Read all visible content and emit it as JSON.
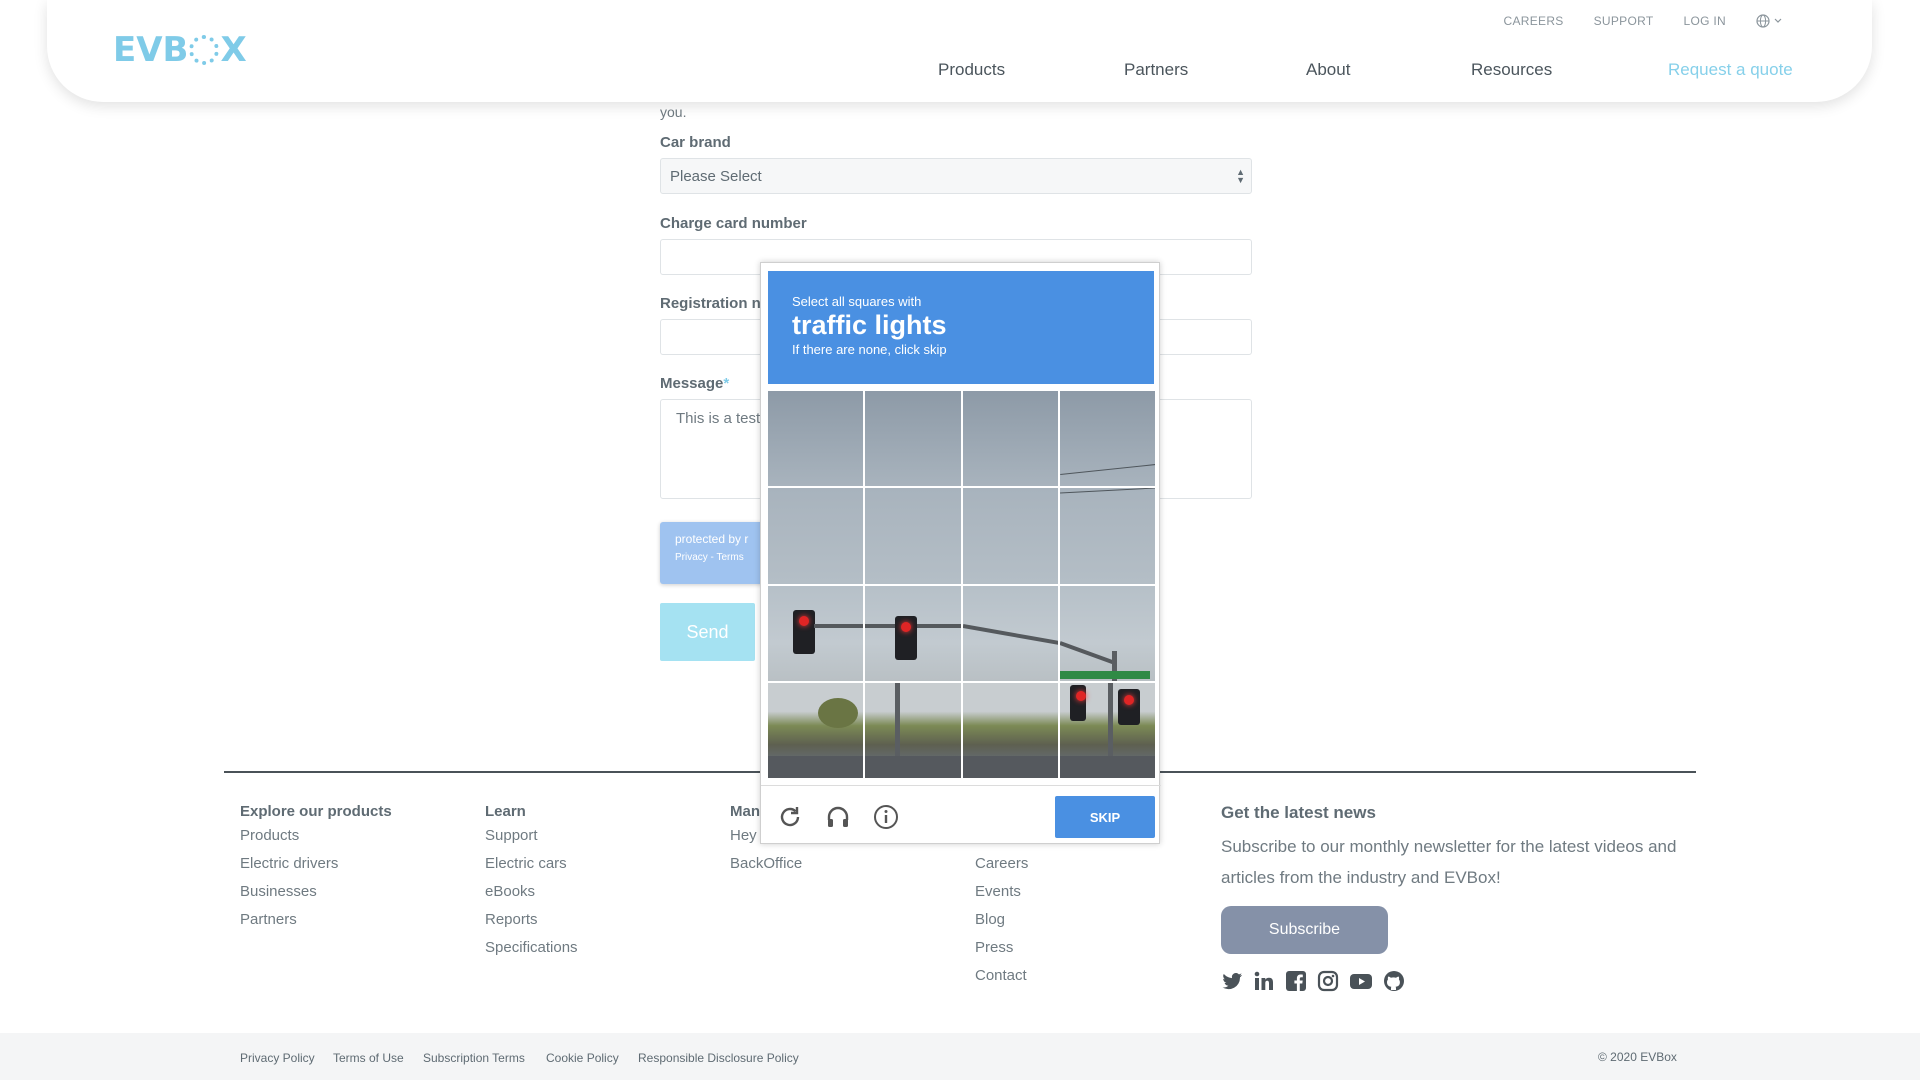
{
  "header": {
    "logo_text_a": "EVB",
    "logo_text_b": "X",
    "top_links": [
      "CAREERS",
      "SUPPORT",
      "LOG IN"
    ],
    "nav": [
      "Products",
      "Partners",
      "About",
      "Resources"
    ],
    "quote": "Request a quote"
  },
  "form": {
    "intro_tail": "you.",
    "car_brand_label": "Car brand",
    "car_brand_value": "Please Select",
    "charge_card_label": "Charge card number",
    "registration_label": "Registration n",
    "message_label": "Message",
    "message_required": "*",
    "message_value": "This is a test",
    "recaptcha_badge": "protected by r",
    "recaptcha_links": "Privacy - Terms",
    "send_label": "Send"
  },
  "captcha": {
    "line1": "Select all squares with",
    "line2": "traffic lights",
    "line3": "If there are none, click skip",
    "skip_label": "SKIP",
    "icons": [
      "reload-icon",
      "audio-icon",
      "info-icon"
    ]
  },
  "footer": {
    "col1": {
      "title": "Explore our products",
      "links": [
        "Products",
        "Electric drivers",
        "Businesses",
        "Partners"
      ]
    },
    "col2": {
      "title": "Learn",
      "links": [
        "Support",
        "Electric cars",
        "eBooks",
        "Reports",
        "Specifications"
      ]
    },
    "col3": {
      "title": "Man",
      "links": [
        "Hey",
        "BackOffice"
      ]
    },
    "col4": {
      "links": [
        "Careers",
        "Events",
        "Blog",
        "Press",
        "Contact"
      ]
    },
    "news_title": "Get the latest news",
    "news_text": "Subscribe to our monthly newsletter for the latest videos and articles from the industry and EVBox!",
    "subscribe_label": "Subscribe",
    "social_icons": [
      "twitter-icon",
      "linkedin-icon",
      "facebook-icon",
      "instagram-icon",
      "youtube-icon",
      "github-icon"
    ]
  },
  "bottombar": {
    "links": [
      "Privacy Policy",
      "Terms of Use",
      "Subscription Terms",
      "Cookie Policy",
      "Responsible Disclosure Policy"
    ],
    "copyright": "© 2020 EVBox"
  },
  "colors": {
    "brand": "#7fcbe8",
    "captcha_blue": "#4a90e2",
    "subscribe": "#8591a8"
  }
}
